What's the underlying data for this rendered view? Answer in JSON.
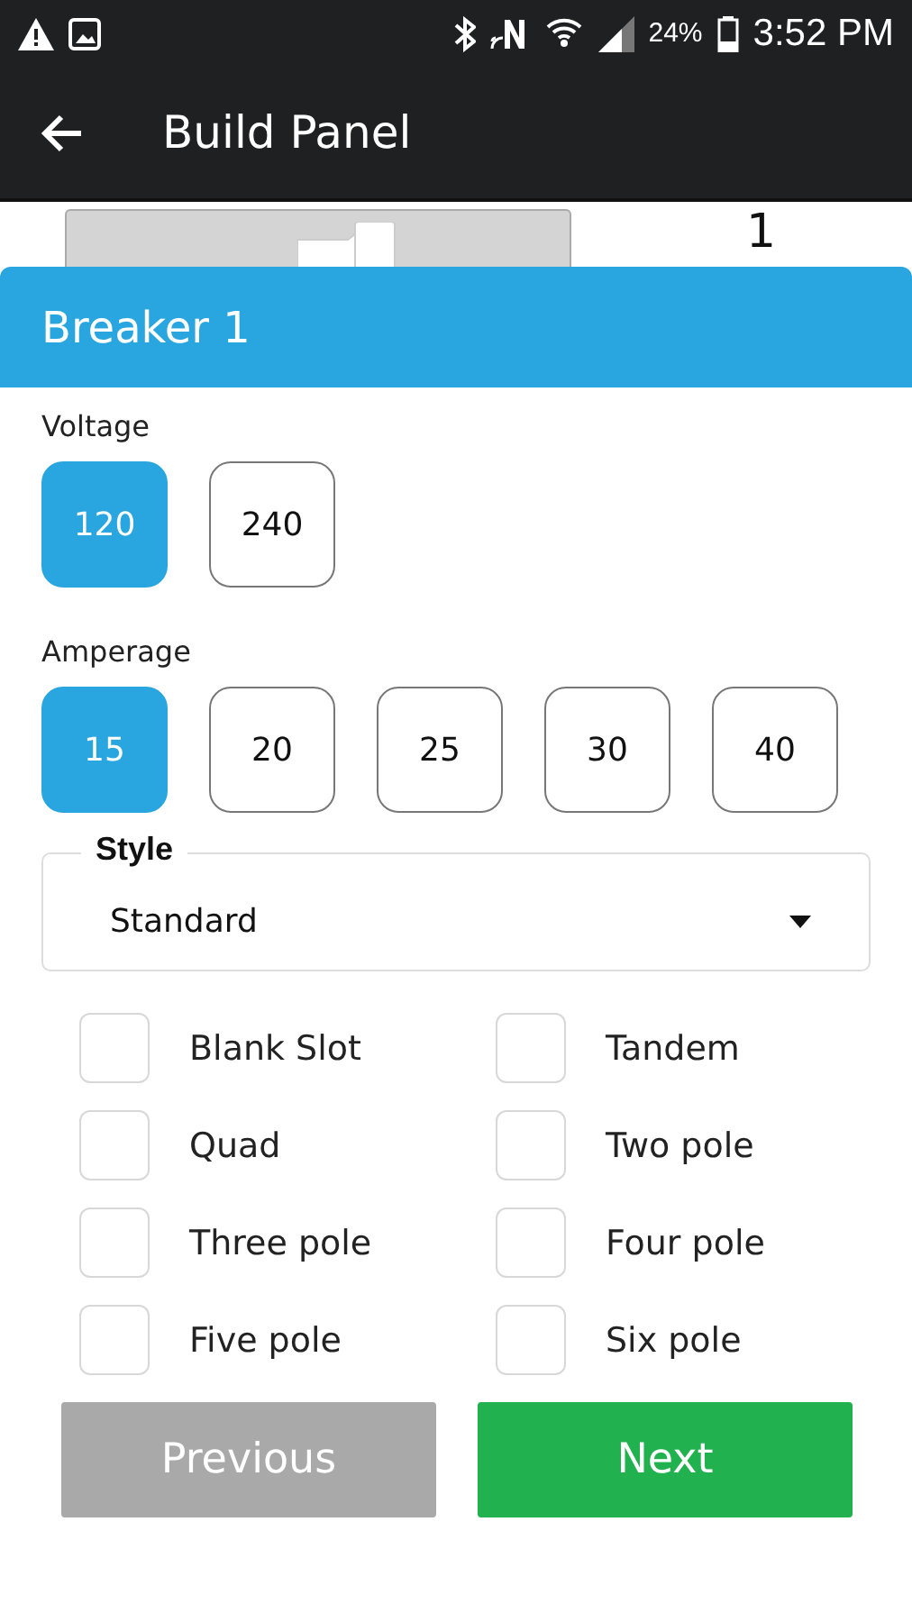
{
  "status_bar": {
    "battery_percent": "24%",
    "time": "3:52 PM"
  },
  "app_bar": {
    "title": "Build Panel"
  },
  "background_panel": {
    "slot_number": "1"
  },
  "dialog": {
    "title": "Breaker 1",
    "voltage": {
      "label": "Voltage",
      "options": [
        {
          "label": "120",
          "selected": true
        },
        {
          "label": "240",
          "selected": false
        }
      ]
    },
    "amperage": {
      "label": "Amperage",
      "options": [
        {
          "label": "15",
          "selected": true
        },
        {
          "label": "20",
          "selected": false
        },
        {
          "label": "25",
          "selected": false
        },
        {
          "label": "30",
          "selected": false
        },
        {
          "label": "40",
          "selected": false
        }
      ]
    },
    "style": {
      "label": "Style",
      "value": "Standard"
    },
    "options": [
      {
        "label": "Blank Slot",
        "checked": false
      },
      {
        "label": "Tandem",
        "checked": false
      },
      {
        "label": "Quad",
        "checked": false
      },
      {
        "label": "Two pole",
        "checked": false
      },
      {
        "label": "Three pole",
        "checked": false
      },
      {
        "label": "Four pole",
        "checked": false
      },
      {
        "label": "Five pole",
        "checked": false
      },
      {
        "label": "Six pole",
        "checked": false
      }
    ],
    "buttons": [
      {
        "label": "Previous",
        "disabled": true
      },
      {
        "label": "Next",
        "disabled": false
      }
    ]
  }
}
